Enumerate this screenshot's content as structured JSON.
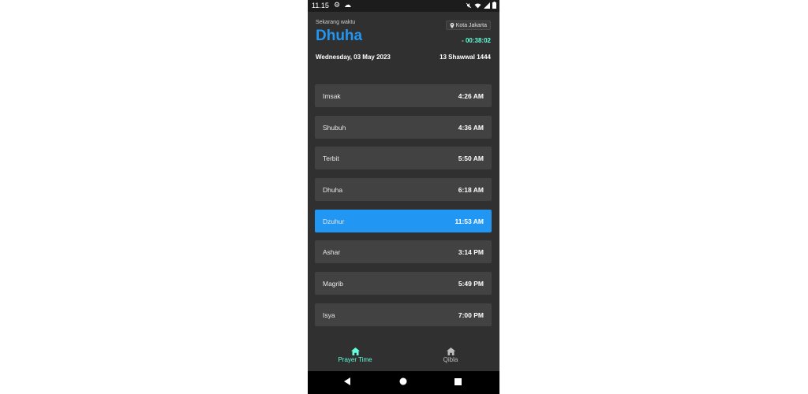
{
  "status_bar": {
    "time": "11.15"
  },
  "header": {
    "subtitle": "Sekarang waktu",
    "current_prayer": "Dhuha",
    "location": "Kota Jakarta",
    "countdown": "- 00:38:02",
    "gregorian_date": "Wednesday, 03 May 2023",
    "hijri_date": "13 Shawwal 1444"
  },
  "prayers": [
    {
      "name": "Imsak",
      "time": "4:26 AM"
    },
    {
      "name": "Shubuh",
      "time": "4:36 AM"
    },
    {
      "name": "Terbit",
      "time": "5:50 AM"
    },
    {
      "name": "Dhuha",
      "time": "6:18 AM"
    },
    {
      "name": "Dzuhur",
      "time": "11:53 AM",
      "active": true
    },
    {
      "name": "Ashar",
      "time": "3:14 PM"
    },
    {
      "name": "Magrib",
      "time": "5:49 PM"
    },
    {
      "name": "Isya",
      "time": "7:00 PM"
    }
  ],
  "bottom_nav": [
    {
      "label": "Prayer Time",
      "icon": "home-icon",
      "selected": true
    },
    {
      "label": "Qibla",
      "icon": "home-icon",
      "selected": false
    }
  ],
  "colors": {
    "accent": "#2196f3",
    "teal": "#64ffda",
    "background": "#303030",
    "card": "#424242"
  }
}
